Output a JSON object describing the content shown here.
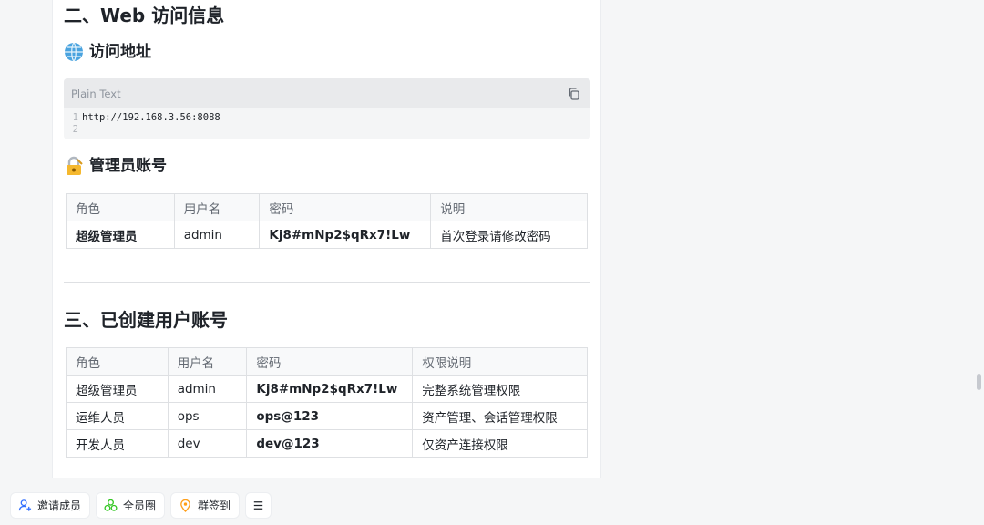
{
  "section2": {
    "title": "二、Web 访问信息",
    "access": {
      "heading": "访问地址",
      "icon": "globe-icon",
      "code": {
        "lang": "Plain Text",
        "lines": [
          {
            "no": "1",
            "text": "http://192.168.3.56:8088"
          },
          {
            "no": "2",
            "text": ""
          }
        ]
      }
    },
    "admin": {
      "heading": "管理员账号",
      "icon": "lock-key-icon",
      "headers": [
        "角色",
        "用户名",
        "密码",
        "说明"
      ],
      "rows": [
        [
          "超级管理员",
          "admin",
          "Kj8#mNp2$qRx7!Lw",
          "首次登录请修改密码"
        ]
      ]
    }
  },
  "section3": {
    "title": "三、已创建用户账号",
    "headers": [
      "角色",
      "用户名",
      "密码",
      "权限说明"
    ],
    "rows": [
      [
        "超级管理员",
        "admin",
        "Kj8#mNp2$qRx7!Lw",
        "完整系统管理权限"
      ],
      [
        "运维人员",
        "ops",
        "ops@123",
        "资产管理、会话管理权限"
      ],
      [
        "开发人员",
        "dev",
        "dev@123",
        "仅资产连接权限"
      ]
    ]
  },
  "bottom_bar": {
    "invite": "邀请成员",
    "circle": "全员圈",
    "checkin": "群签到"
  },
  "colors": {
    "invite_icon": "#3370ff",
    "circle_icon": "#34c724",
    "checkin_icon": "#ff9f1a"
  }
}
